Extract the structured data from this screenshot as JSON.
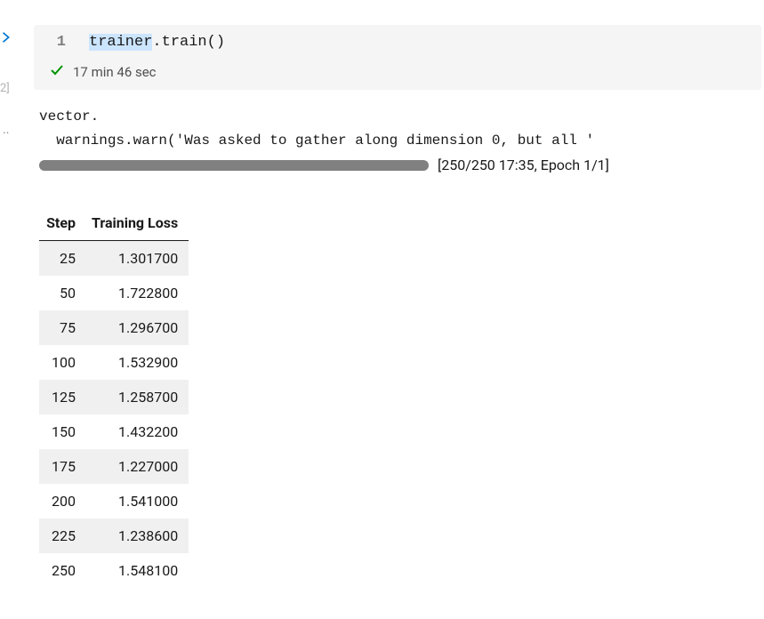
{
  "cell": {
    "line_number": "1",
    "code_obj": "trainer",
    "code_method": ".train()",
    "index": "2]",
    "status_time": "17 min 46 sec"
  },
  "output": {
    "line1": "vector.",
    "line2": "  warnings.warn('Was asked to gather along dimension 0, but all '",
    "progress_text": "[250/250 17:35, Epoch 1/1]"
  },
  "table": {
    "headers": [
      "Step",
      "Training Loss"
    ],
    "rows": [
      {
        "step": "25",
        "loss": "1.301700"
      },
      {
        "step": "50",
        "loss": "1.722800"
      },
      {
        "step": "75",
        "loss": "1.296700"
      },
      {
        "step": "100",
        "loss": "1.532900"
      },
      {
        "step": "125",
        "loss": "1.258700"
      },
      {
        "step": "150",
        "loss": "1.432200"
      },
      {
        "step": "175",
        "loss": "1.227000"
      },
      {
        "step": "200",
        "loss": "1.541000"
      },
      {
        "step": "225",
        "loss": "1.238600"
      },
      {
        "step": "250",
        "loss": "1.548100"
      }
    ]
  }
}
